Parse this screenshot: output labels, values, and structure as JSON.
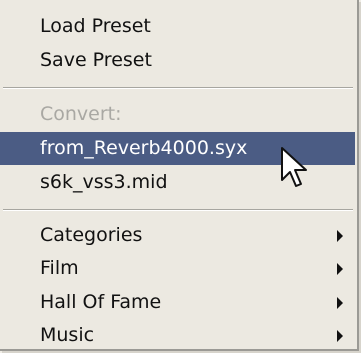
{
  "menu": {
    "items": [
      {
        "label": "Load Preset"
      },
      {
        "label": "Save Preset"
      },
      {
        "label": "Convert:"
      },
      {
        "label": "from_Reverb4000.syx"
      },
      {
        "label": "s6k_vss3.mid"
      },
      {
        "label": "Categories"
      },
      {
        "label": "Film"
      },
      {
        "label": "Hall Of Fame"
      },
      {
        "label": "Music"
      }
    ]
  },
  "colors": {
    "menu_background": "#ece9e1",
    "highlight": "#4b5c84",
    "disabled_text": "#a9a8a3",
    "text": "#111111"
  },
  "icons": {
    "submenu": "chevron-right-icon",
    "pointer": "mouse-pointer-icon"
  }
}
